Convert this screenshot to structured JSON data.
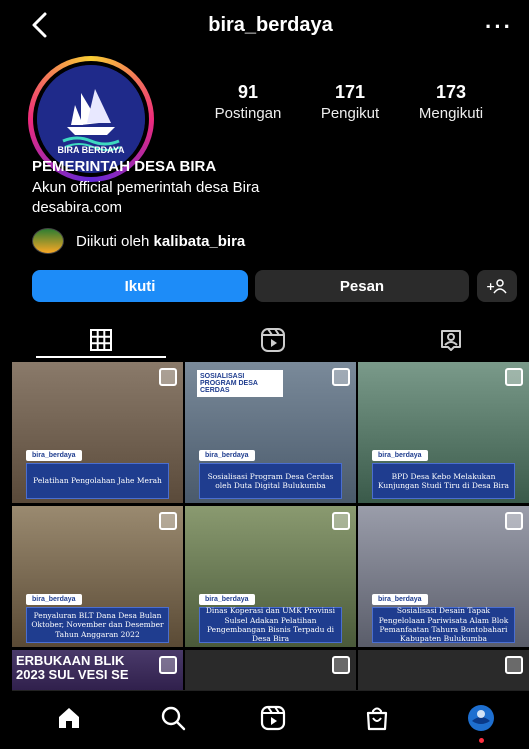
{
  "header": {
    "username": "bira_berdaya",
    "more_label": "···"
  },
  "profile": {
    "avatar_text": "BIRA BERDAYA",
    "stats": [
      {
        "value": "91",
        "label": "Postingan"
      },
      {
        "value": "171",
        "label": "Pengikut"
      },
      {
        "value": "173",
        "label": "Mengikuti"
      }
    ],
    "name": "PEMERINTAH DESA BIRA",
    "bio": "Akun official pemerintah desa Bira",
    "link": "desabira.com",
    "followed_prefix": "Diikuti oleh ",
    "followed_by": "kalibata_bira"
  },
  "actions": {
    "follow": "Ikuti",
    "message": "Pesan",
    "add_person": "+8"
  },
  "tabs": [
    "grid-icon",
    "reels-icon",
    "tagged-icon"
  ],
  "posts": [
    {
      "brand": "bira_berdaya",
      "caption": "Pelatihan Pengolahan Jahe Merah",
      "bg": "#6b5a4a"
    },
    {
      "brand": "bira_berdaya",
      "caption": "Sosialisasi Program Desa Cerdas oleh Duta Digital Bulukumba",
      "bg": "#4a5a6b",
      "headline": "SOSIALISASI PROGRAM DESA CERDAS"
    },
    {
      "brand": "bira_berdaya",
      "caption": "BPD Desa Kebo Melakukan Kunjungan Studi Tiru di Desa Bira",
      "bg": "#5a6b5a"
    },
    {
      "brand": "bira_berdaya",
      "caption": "Penyaluran BLT Dana Desa Bulan Oktober, November dan Desember Tahun Anggaran 2022",
      "bg": "#7a6a55"
    },
    {
      "brand": "bira_berdaya",
      "caption": "Dinas Koperasi dan UMK Provinsi Sulsel Adakan Pelatihan Pengembangan Bisnis Terpadu di Desa Bira",
      "bg": "#5c6c50"
    },
    {
      "brand": "bira_berdaya",
      "caption": "Sosialisasi Desain Tapak Pengelolaan Pariwisata Alam Blok Pemanfaatan Tahura Bontobahari Kabupaten Bulukumba",
      "bg": "#6a6d7a"
    },
    {
      "headline": "ERBUKAAN BLIK 2023 SUL VESI SE",
      "bg": "#3a2a55"
    },
    {
      "bg": "#2a2a2a"
    },
    {
      "bg": "#2a2a2a"
    }
  ],
  "bottom_nav": [
    "home-icon",
    "search-icon",
    "reels-icon",
    "shop-icon",
    "profile-avatar"
  ],
  "colors": {
    "follow_blue": "#1d8cf8",
    "button_gray": "#2b2b2b",
    "caption_blue": "#1f3d8f"
  }
}
